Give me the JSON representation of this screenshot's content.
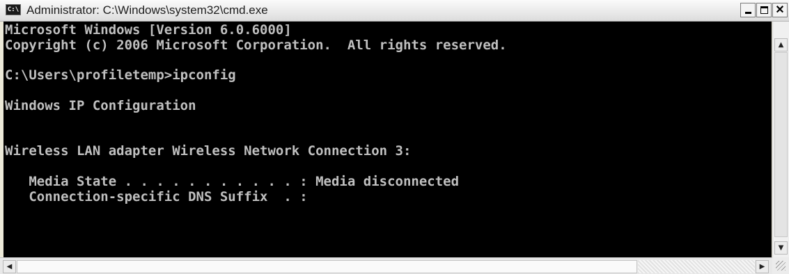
{
  "window": {
    "title": "Administrator: C:\\Windows\\system32\\cmd.exe",
    "icon_text": "C:\\",
    "icon": "console-app-icon",
    "controls": {
      "minimize": "minimize-icon",
      "maximize": "maximize-icon",
      "close": "close-icon",
      "close_label": "✕"
    }
  },
  "console": {
    "lines": [
      "Microsoft Windows [Version 6.0.6000]",
      "Copyright (c) 2006 Microsoft Corporation.  All rights reserved.",
      "",
      "C:\\Users\\profiletemp>ipconfig",
      "",
      "Windows IP Configuration",
      "",
      "",
      "Wireless LAN adapter Wireless Network Connection 3:",
      "",
      "   Media State . . . . . . . . . . . : Media disconnected",
      "   Connection-specific DNS Suffix  . :"
    ],
    "colors": {
      "background": "#000000",
      "text": "#c0c0c0"
    }
  },
  "scrollbars": {
    "up_arrow": "▲",
    "down_arrow": "▼",
    "left_arrow": "◀",
    "right_arrow": "▶"
  }
}
